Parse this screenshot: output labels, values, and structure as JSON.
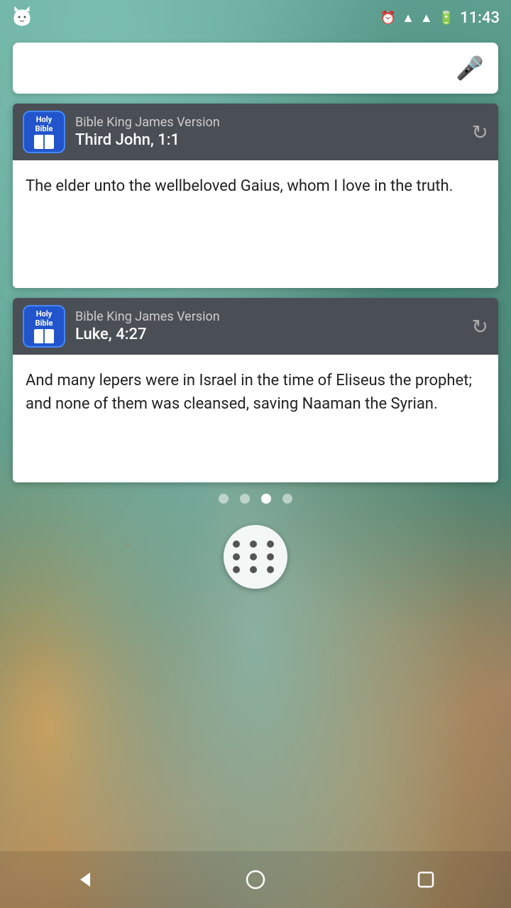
{
  "status_bar": {
    "time": "11:43",
    "icons": [
      "clock",
      "wifi",
      "signal",
      "battery"
    ]
  },
  "search_bar": {
    "placeholder": "",
    "mic_label": "🎤"
  },
  "card1": {
    "app_name": "Bible King James Version",
    "verse_ref": "Third John, 1:1",
    "verse_text": "The elder unto the wellbeloved Gaius, whom I love in the truth.",
    "icon_line1": "Holy",
    "icon_line2": "Bible",
    "refresh_label": "↻"
  },
  "card2": {
    "app_name": "Bible King James Version",
    "verse_ref": "Luke, 4:27",
    "verse_text": "And many lepers were in Israel in the time of Eliseus the prophet; and none of them was cleansed, saving Naaman the Syrian.",
    "icon_line1": "Holy",
    "icon_line2": "Bible",
    "refresh_label": "↻"
  },
  "page_dots": {
    "total": 4,
    "active_index": 2
  },
  "nav": {
    "back_label": "◁",
    "home_label": "○",
    "recents_label": "□"
  }
}
